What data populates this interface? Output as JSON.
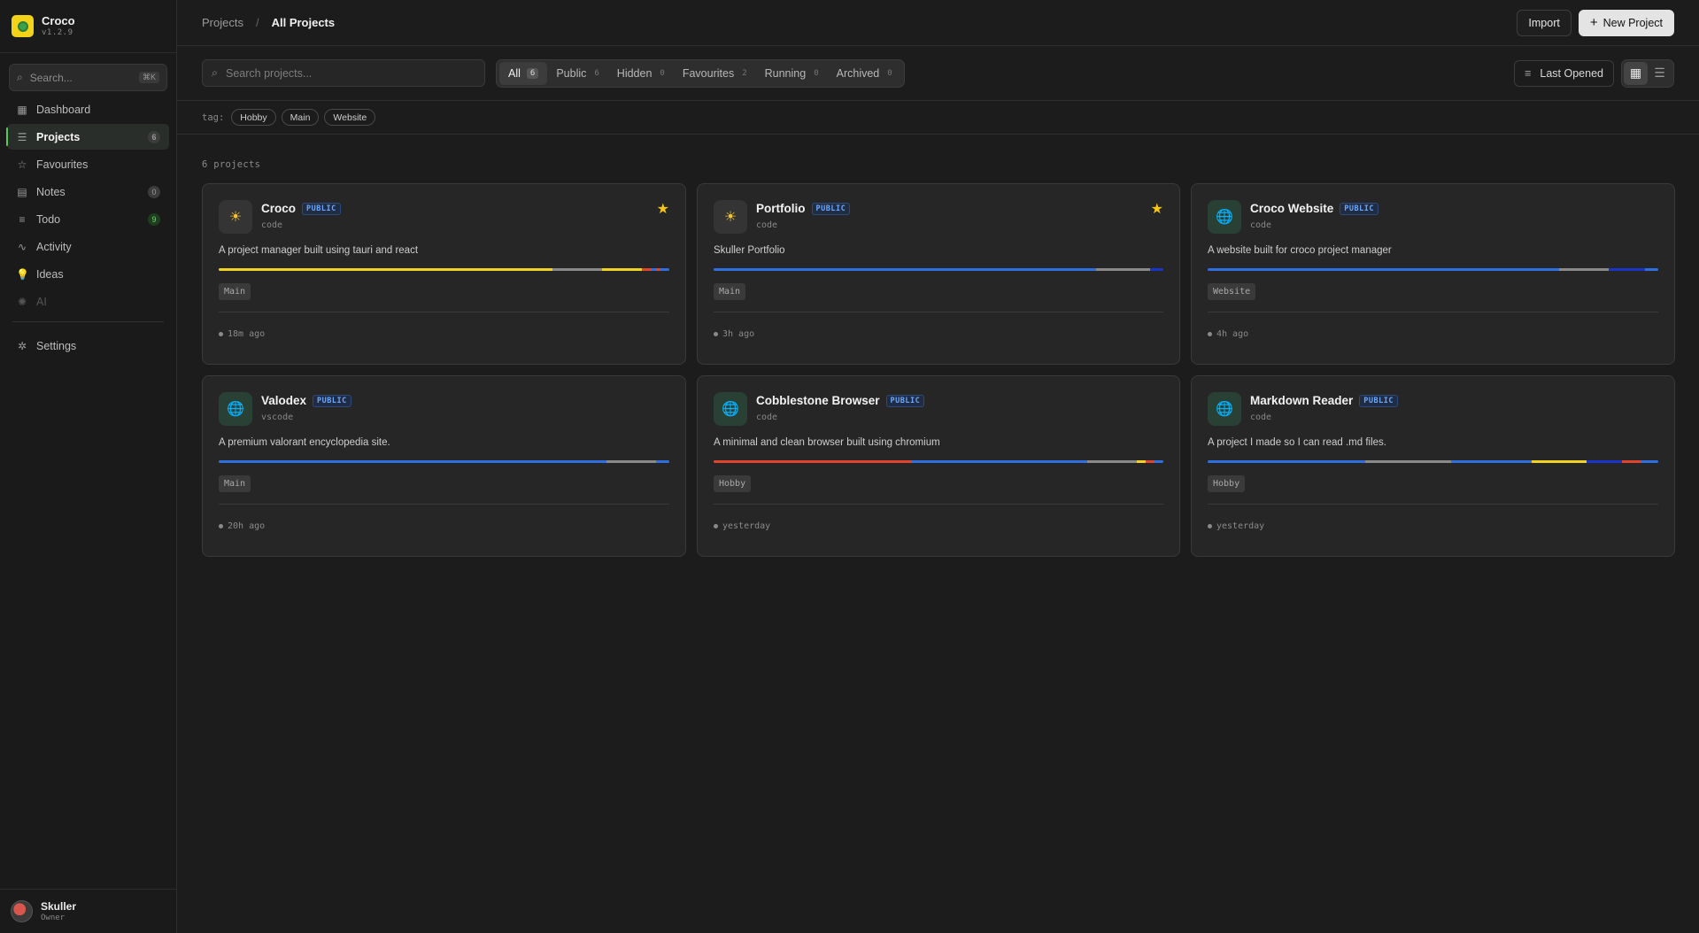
{
  "app": {
    "name": "Croco",
    "version": "v1.2.9"
  },
  "sidebar": {
    "search_placeholder": "Search...",
    "search_shortcut": "⌘K",
    "items": [
      {
        "label": "Dashboard",
        "icon": "dashboard-icon",
        "glyph": "▦",
        "badge": ""
      },
      {
        "label": "Projects",
        "icon": "projects-icon",
        "glyph": "☰",
        "badge": "6",
        "active": true
      },
      {
        "label": "Favourites",
        "icon": "star-icon",
        "glyph": "☆",
        "badge": ""
      },
      {
        "label": "Notes",
        "icon": "note-icon",
        "glyph": "▤",
        "badge": "0"
      },
      {
        "label": "Todo",
        "icon": "list-icon",
        "glyph": "≡",
        "badge": "9",
        "badge_green": true
      },
      {
        "label": "Activity",
        "icon": "activity-icon",
        "glyph": "∿",
        "badge": ""
      },
      {
        "label": "Ideas",
        "icon": "bulb-icon",
        "glyph": "💡",
        "badge": ""
      },
      {
        "label": "AI",
        "icon": "ai-icon",
        "glyph": "✺",
        "badge": "",
        "disabled": true
      }
    ],
    "settings_label": "Settings",
    "user": {
      "name": "Skuller",
      "role": "Owner"
    }
  },
  "header": {
    "breadcrumb_root": "Projects",
    "breadcrumb_sep": "/",
    "breadcrumb_current": "All Projects",
    "import_label": "Import",
    "new_project_label": "New Project"
  },
  "toolbar": {
    "search_placeholder": "Search projects...",
    "filters": [
      {
        "label": "All",
        "count": "6"
      },
      {
        "label": "Public",
        "count": "6"
      },
      {
        "label": "Hidden",
        "count": "0"
      },
      {
        "label": "Favourites",
        "count": "2"
      },
      {
        "label": "Running",
        "count": "0"
      },
      {
        "label": "Archived",
        "count": "0"
      }
    ],
    "sort_label": "Last Opened"
  },
  "tags": {
    "label": "tag:",
    "items": [
      "Hobby",
      "Main",
      "Website"
    ]
  },
  "projects_count": "6 projects",
  "colors": {
    "yellow": "#f0d323",
    "gray": "#8a8a8a",
    "blue": "#2f6fe0",
    "red": "#e0462f",
    "purple": "#7a4fd6",
    "navy": "#1a35c9"
  },
  "projects": [
    {
      "title": "Croco",
      "badge": "PUBLIC",
      "type": "code",
      "icon": "sun-icon",
      "desc": "A project manager built using tauri and react",
      "tag": "Main",
      "time": "18m ago",
      "starred": true,
      "langs": [
        {
          "c": "#f0d323",
          "p": 74
        },
        {
          "c": "#8a8a8a",
          "p": 11
        },
        {
          "c": "#f0d323",
          "p": 9
        },
        {
          "c": "#e0462f",
          "p": 2
        },
        {
          "c": "#2f6fe0",
          "p": 1
        },
        {
          "c": "#e0462f",
          "p": 1
        },
        {
          "c": "#2f6fe0",
          "p": 2
        }
      ]
    },
    {
      "title": "Portfolio",
      "badge": "PUBLIC",
      "type": "code",
      "icon": "sun-icon",
      "desc": "Skuller Portfolio",
      "tag": "Main",
      "time": "3h ago",
      "starred": true,
      "langs": [
        {
          "c": "#2f6fe0",
          "p": 85
        },
        {
          "c": "#8a8a8a",
          "p": 12
        },
        {
          "c": "#1a35c9",
          "p": 3
        }
      ]
    },
    {
      "title": "Croco Website",
      "badge": "PUBLIC",
      "type": "code",
      "icon": "globe-icon",
      "desc": "A website built for croco project manager",
      "tag": "Website",
      "time": "4h ago",
      "starred": false,
      "langs": [
        {
          "c": "#2f6fe0",
          "p": 78
        },
        {
          "c": "#8a8a8a",
          "p": 11
        },
        {
          "c": "#1a35c9",
          "p": 8
        },
        {
          "c": "#2f6fe0",
          "p": 3
        }
      ]
    },
    {
      "title": "Valodex",
      "badge": "PUBLIC",
      "type": "vscode",
      "icon": "globe-icon",
      "desc": "A premium valorant encyclopedia site.",
      "tag": "Main",
      "time": "20h ago",
      "starred": false,
      "langs": [
        {
          "c": "#2f6fe0",
          "p": 86
        },
        {
          "c": "#8a8a8a",
          "p": 11
        },
        {
          "c": "#2f6fe0",
          "p": 3
        }
      ]
    },
    {
      "title": "Cobblestone Browser",
      "badge": "PUBLIC",
      "type": "code",
      "icon": "globe-icon",
      "desc": "A minimal and clean browser built using chromium",
      "tag": "Hobby",
      "time": "yesterday",
      "starred": false,
      "langs": [
        {
          "c": "#e0462f",
          "p": 44
        },
        {
          "c": "#2f6fe0",
          "p": 39
        },
        {
          "c": "#8a8a8a",
          "p": 11
        },
        {
          "c": "#f0d323",
          "p": 2
        },
        {
          "c": "#e0462f",
          "p": 2
        },
        {
          "c": "#2f6fe0",
          "p": 2
        }
      ]
    },
    {
      "title": "Markdown Reader",
      "badge": "PUBLIC",
      "type": "code",
      "icon": "globe-icon",
      "desc": "A project I made so I can read .md files.",
      "tag": "Hobby",
      "time": "yesterday",
      "starred": false,
      "langs": [
        {
          "c": "#2f6fe0",
          "p": 35
        },
        {
          "c": "#8a8a8a",
          "p": 19
        },
        {
          "c": "#2f6fe0",
          "p": 18
        },
        {
          "c": "#f0d323",
          "p": 12
        },
        {
          "c": "#1a35c9",
          "p": 8
        },
        {
          "c": "#e0462f",
          "p": 4
        },
        {
          "c": "#2f6fe0",
          "p": 4
        }
      ]
    }
  ]
}
